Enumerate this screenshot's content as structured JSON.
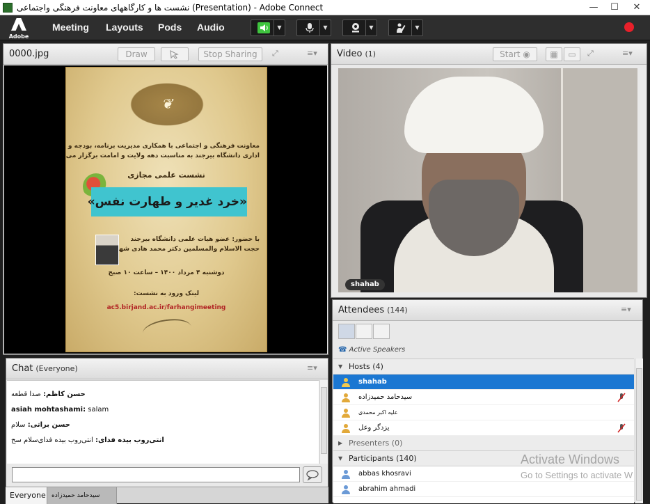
{
  "window": {
    "title": "نشست ها و کارگاههای معاونت فرهنگی واجتماعی (Presentation) - Adobe Connect",
    "minimize": "—",
    "maximize": "☐",
    "close": "✕"
  },
  "menubar": {
    "logo_text": "Adobe",
    "items": [
      "Meeting",
      "Layouts",
      "Pods",
      "Audio"
    ],
    "colors": {
      "speaker_active": "#3fc43f",
      "record": "#e8202a"
    }
  },
  "share_pod": {
    "title": "0000.jpg",
    "draw_label": "Draw",
    "stop_sharing_label": "Stop Sharing",
    "poster": {
      "heading_lines": [
        "معاونت فرهنگی و اجتماعی با همکاری مدیریت برنامه، بودجه و تحول",
        "اداری دانشگاه بیرجند به مناسبت دهه ولایت و امامت برگزار می کند:"
      ],
      "subtitle": "نشست علمی مجازی",
      "banner": "«خرد غدیر و طهارت نفس»",
      "presence": "با حضور: عضو هیات علمی دانشگاه بیرجند",
      "speaker": "حجت الاسلام والمسلمین دکتر محمد هادی شهاب",
      "datetime": "دوشنبه ۴ مرداد ۱۴۰۰ – ساعت ۱۰ صبح",
      "link_heading": "لینک ورود به نشست:",
      "link": "ac5.birjand.ac.ir/farhangimeeting"
    }
  },
  "video_pod": {
    "title": "Video",
    "count": "(1)",
    "start_label": "Start",
    "participant_name": "shahab"
  },
  "attendees_pod": {
    "title": "Attendees",
    "count": "(144)",
    "active_speakers_label": "Active Speakers",
    "hosts": {
      "label": "Hosts (4)",
      "members": [
        "shahab",
        "سیدحامد حمیدزاده",
        "علیه اکبر محمدی",
        "یزدگر وعل"
      ]
    },
    "presenters": {
      "label": "Presenters (0)"
    },
    "participants": {
      "label": "Participants (140)",
      "members": [
        "abbas khosravi",
        "abrahim ahmadi"
      ]
    }
  },
  "chat_pod": {
    "title": "Chat",
    "scope": "(Everyone)",
    "messages": [
      {
        "sender": "حسن کاظم:",
        "text": "صدا قطعه"
      },
      {
        "sender": "asiah mohtashami:",
        "text": "salam"
      },
      {
        "sender": "حسن براتی:",
        "text": "سلام"
      },
      {
        "sender": "انتی‌روب بیده فدای:",
        "text": "انتی‌روب بیده فدای‌سلام سح"
      }
    ],
    "tabs": [
      "Everyone",
      "سیدحامد حمیدزاده"
    ]
  },
  "watermark": {
    "line1": "Activate Windows",
    "line2": "Go to Settings to activate W"
  }
}
